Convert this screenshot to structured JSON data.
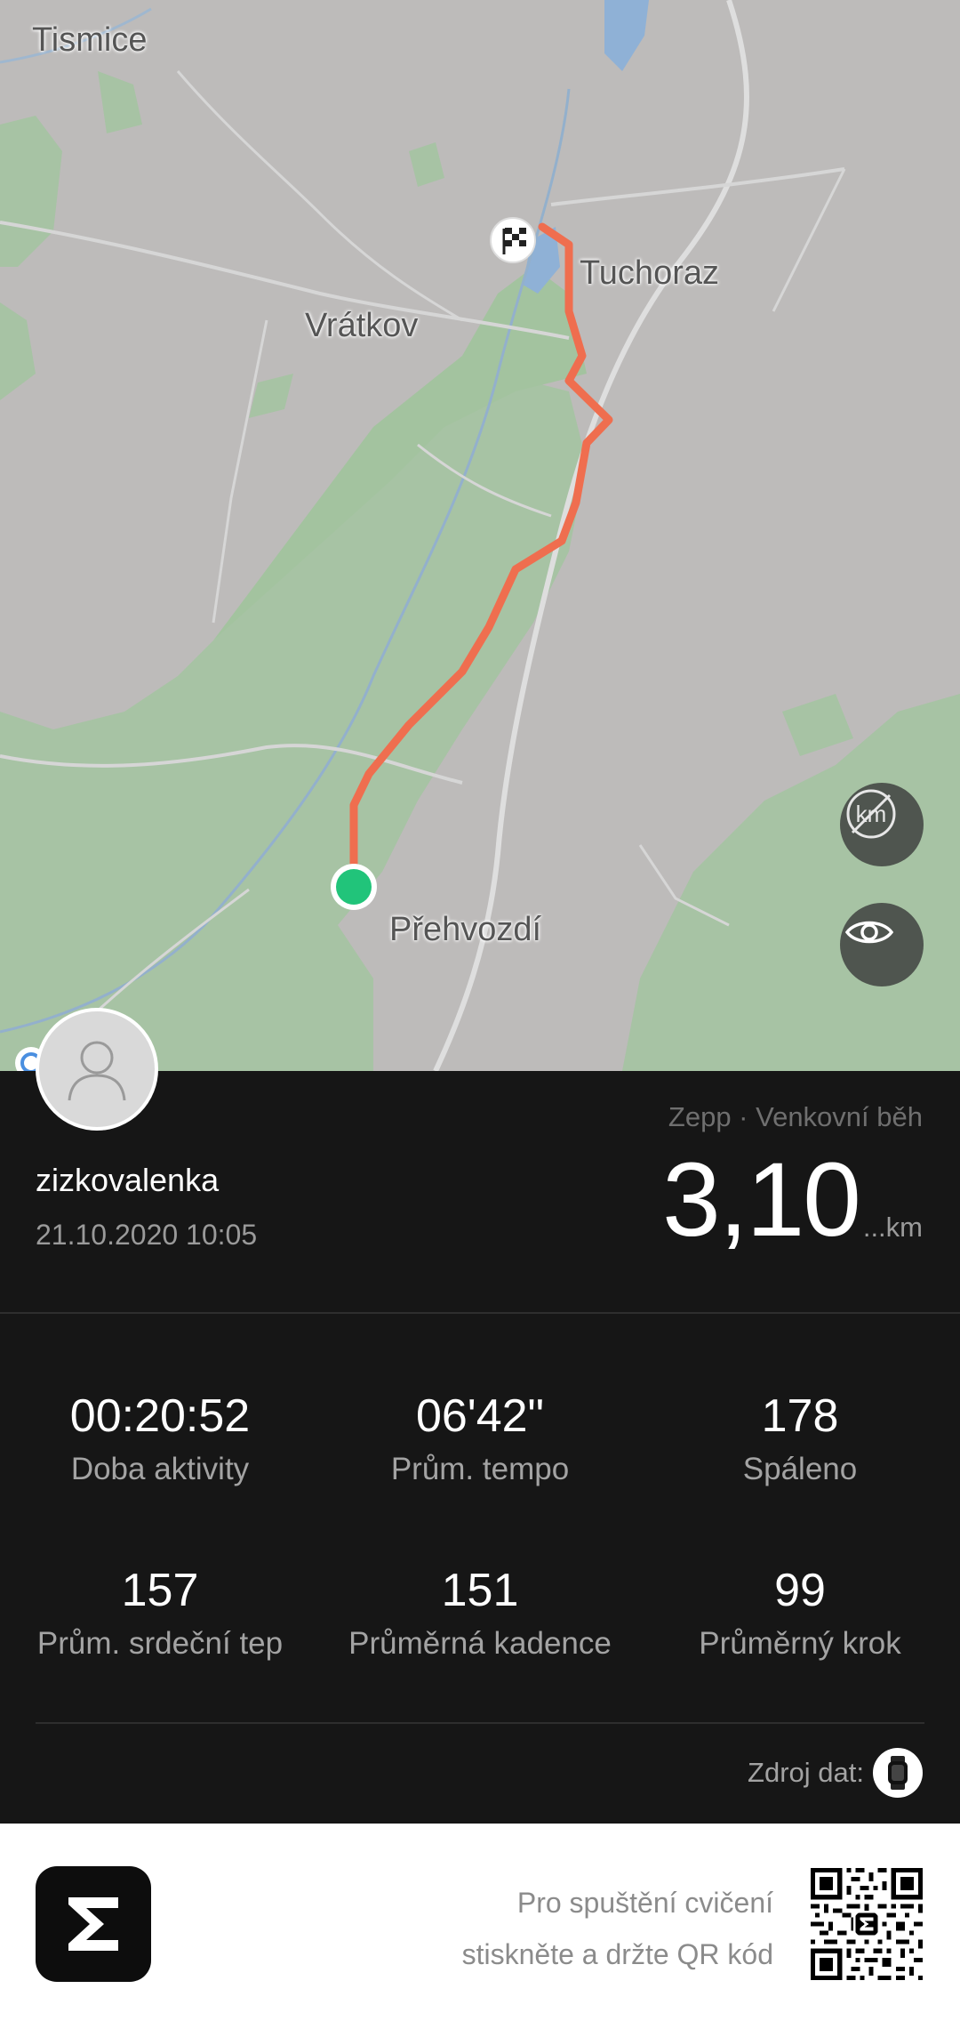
{
  "map": {
    "places": {
      "tismice": "Tismice",
      "tuchoraz": "Tuchoraz",
      "vratkov": "Vrátkov",
      "prehvozdi": "Přehvozdí"
    },
    "route_color": "#ef6e4f",
    "start_color": "#21c47a",
    "buttons": [
      "km-markers-off-icon",
      "eye-icon"
    ]
  },
  "workout": {
    "username": "zizkovalenka",
    "datetime": "21.10.2020 10:05",
    "source": "Zepp · Venkovní běh",
    "distance": "3,10",
    "distance_unit": "...km"
  },
  "stats": [
    {
      "value": "00:20:52",
      "label": "Doba aktivity"
    },
    {
      "value": "06'42\"",
      "label": "Prům. tempo"
    },
    {
      "value": "178",
      "label": "Spáleno"
    },
    {
      "value": "157",
      "label": "Prům. srdeční tep"
    },
    {
      "value": "151",
      "label": "Průměrná kadence"
    },
    {
      "value": "99",
      "label": "Průměrný krok"
    }
  ],
  "data_source": {
    "label": "Zdroj dat:"
  },
  "footer": {
    "qr_line1": "Pro spuštění cvičení",
    "qr_line2": "stiskněte a držte QR kód"
  }
}
